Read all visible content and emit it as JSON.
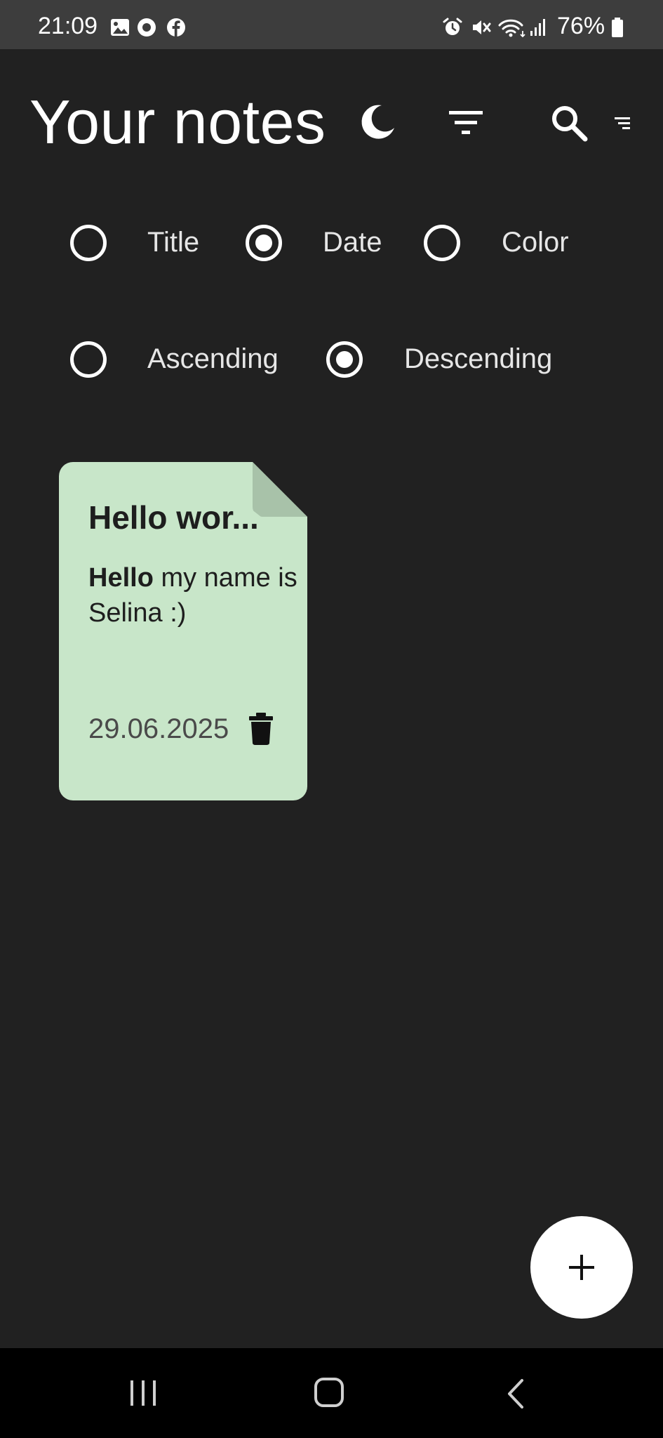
{
  "status_bar": {
    "time": "21:09",
    "battery": "76%",
    "left_icons": [
      "gallery-icon",
      "circle-app-icon",
      "facebook-icon"
    ],
    "right_icons": [
      "alarm-icon",
      "mute-icon",
      "wifi-icon",
      "signal-icon",
      "battery-icon"
    ]
  },
  "header": {
    "title": "Your notes",
    "actions": [
      "dark-mode-icon",
      "filter-icon",
      "search-icon",
      "sort-icon"
    ]
  },
  "sort_by": {
    "options": [
      {
        "label": "Title",
        "checked": false
      },
      {
        "label": "Date",
        "checked": true
      },
      {
        "label": "Color",
        "checked": false
      }
    ]
  },
  "order": {
    "options": [
      {
        "label": "Ascending",
        "checked": false
      },
      {
        "label": "Descending",
        "checked": true
      }
    ]
  },
  "notes": [
    {
      "title": "Hello wor...",
      "body_bold": "Hello",
      "body_rest": " my name is Selina :)",
      "date": "29.06.2025",
      "color": "#c8e6c9"
    }
  ],
  "fab": {
    "icon": "plus-icon"
  },
  "nav_bar": {
    "icons": [
      "recent-apps-icon",
      "home-icon",
      "back-icon"
    ]
  },
  "colors": {
    "background": "#212121",
    "status_bar": "#3d3d3d",
    "note_green": "#c8e6c9",
    "nav_bar": "#000000"
  }
}
